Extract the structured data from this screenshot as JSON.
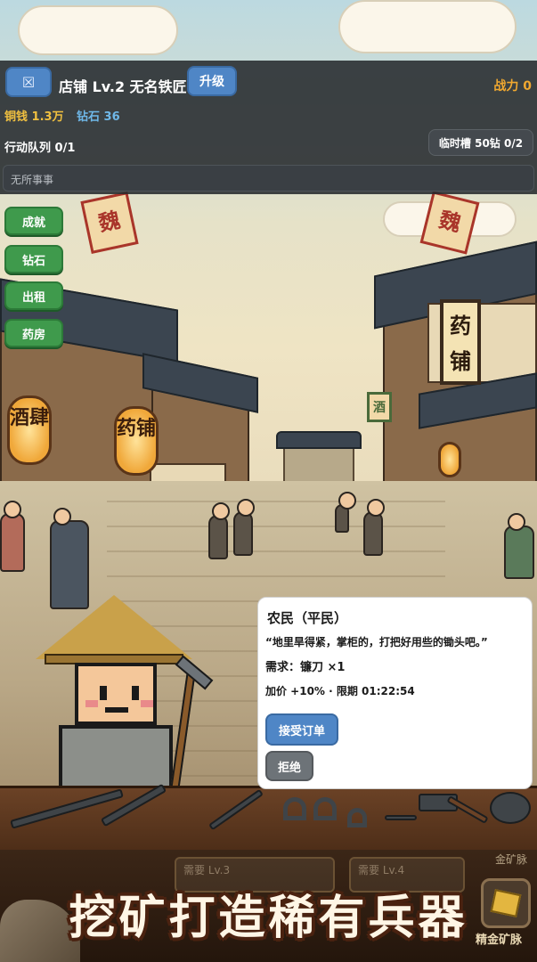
{
  "header": {
    "menu_icon": "☒",
    "shop_title": "店铺 Lv.2 无名铁匠",
    "upgrade_label": "升级",
    "power": "战力 0"
  },
  "resources": {
    "copper": "铜钱 1.3万",
    "diamond": "钻石 36"
  },
  "queue": {
    "action_queue": "行动队列 0/1",
    "temp_slot": "临时槽 50钻 0/2",
    "idle_status": "无所事事"
  },
  "side_menu": [
    {
      "label": "成就"
    },
    {
      "label": "钻石"
    },
    {
      "label": "出租"
    },
    {
      "label": "药房"
    }
  ],
  "order": {
    "customer": "农民（平民）",
    "quote": "“地里旱得紧，掌柜的，打把好用些的锄头吧。”",
    "requirement": "需求：镰刀 ×1",
    "price_deadline": "加价 +10% · 限期 01:22:54",
    "accept_label": "接受订单",
    "reject_label": "拒绝"
  },
  "scene_signs": {
    "wine_lantern": "酒肆",
    "medicine_lantern": "药铺",
    "medicine_board": "药铺",
    "flag_left": "魏",
    "flag_right": "魏",
    "flag_small": "酒"
  },
  "banner": {
    "slogan": "挖矿打造稀有兵器",
    "gold_mine": "精金矿脉",
    "gold_mine_top": "金矿脉",
    "slot_a": "需要 Lv.3",
    "slot_b": "需要 Lv.4"
  },
  "colors": {
    "primary_button": "#4f86c6",
    "side_button": "#3f9a4c",
    "copper": "#f0c040",
    "diamond": "#6fb8e8",
    "power": "#f0a830"
  }
}
